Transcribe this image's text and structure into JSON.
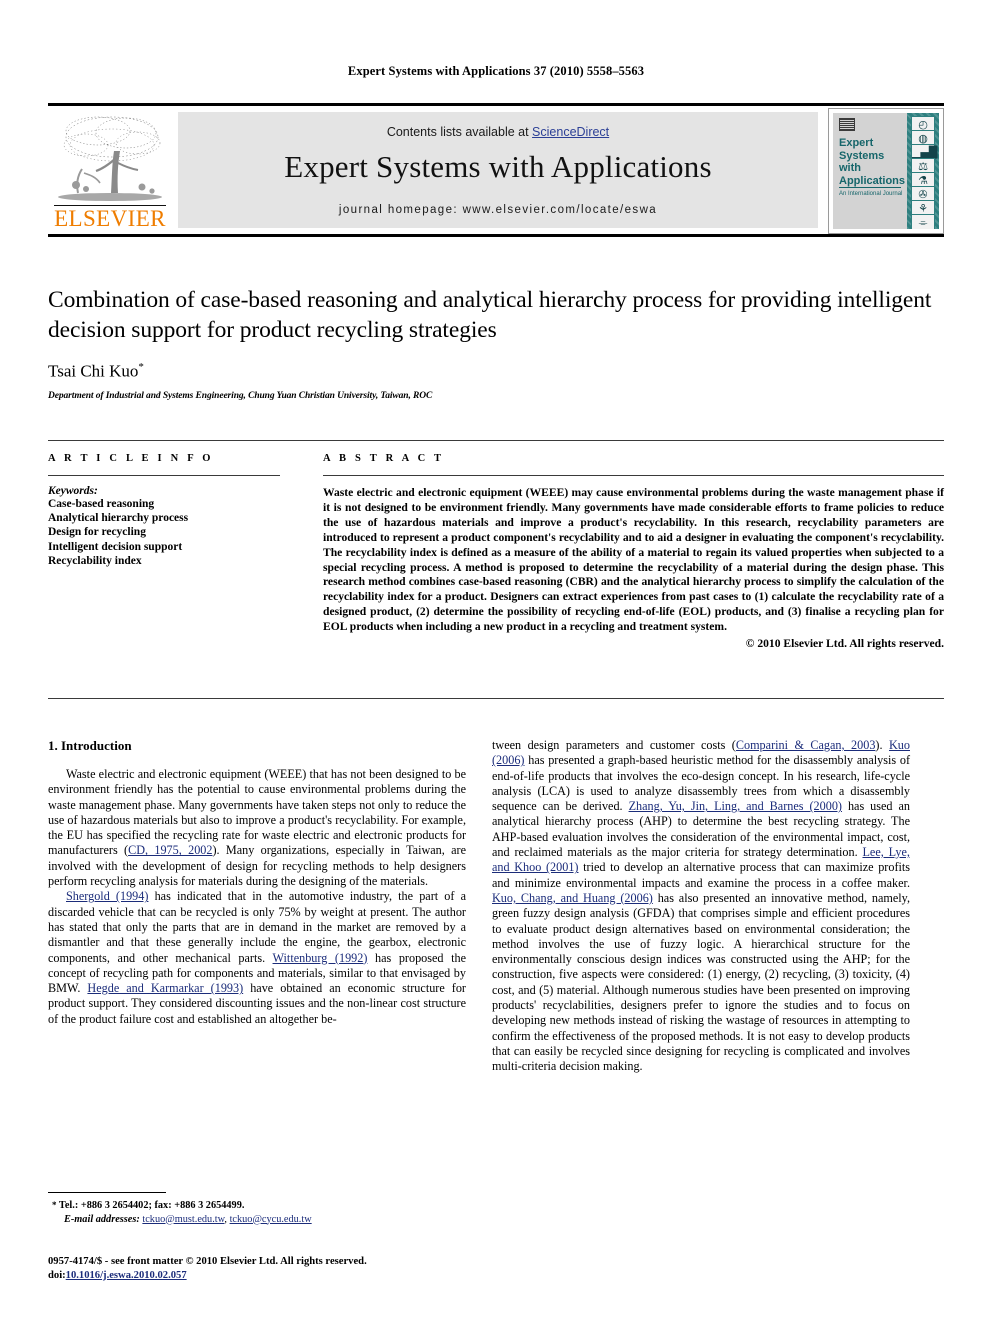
{
  "running_head": "Expert Systems with Applications 37 (2010) 5558–5563",
  "masthead": {
    "contents_prefix": "Contents lists available at ",
    "sciencedirect": "ScienceDirect",
    "journal_title": "Expert Systems with Applications",
    "homepage": "journal homepage: www.elsevier.com/locate/eswa",
    "publisher_name": "ELSEVIER",
    "publisher_logo_icon": "elsevier-tree-icon",
    "cover": {
      "title": "Expert Systems with Applications",
      "subtitle": "An International Journal",
      "strip_icons": [
        "clock-icon",
        "globe-icon",
        "bar-chart-icon",
        "scales-icon",
        "microscope-icon",
        "satellite-icon",
        "lab-flask-icon",
        "tower-icon"
      ],
      "accent_color": "#2e7f7f"
    }
  },
  "article": {
    "title": "Combination of case-based reasoning and analytical hierarchy process for providing intelligent decision support for product recycling strategies",
    "author": "Tsai Chi Kuo",
    "author_marker": "*",
    "affiliation": "Department of Industrial and Systems Engineering, Chung Yuan Christian University, Taiwan, ROC"
  },
  "article_info": {
    "heading": "A R T I C L E    I N F O",
    "keywords_label": "Keywords:",
    "keywords": [
      "Case-based reasoning",
      "Analytical hierarchy process",
      "Design for recycling",
      "Intelligent decision support",
      "Recyclability index"
    ]
  },
  "abstract": {
    "heading": "A B S T R A C T",
    "text": "Waste electric and electronic equipment (WEEE) may cause environmental problems during the waste management phase if it is not designed to be environment friendly. Many governments have made considerable efforts to frame policies to reduce the use of hazardous materials and improve a product's recyclability. In this research, recyclability parameters are introduced to represent a product component's recyclability and to aid a designer in evaluating the component's recyclability. The recyclability index is defined as a measure of the ability of a material to regain its valued properties when subjected to a special recycling process. A method is proposed to determine the recyclability of a material during the design phase. This research method combines case-based reasoning (CBR) and the analytical hierarchy process to simplify the calculation of the recyclability index for a product. Designers can extract experiences from past cases to (1) calculate the recyclability rate of a designed product, (2) determine the possibility of recycling end-of-life (EOL) products, and (3) finalise a recycling plan for EOL products when including a new product in a recycling and treatment system.",
    "copyright": "© 2010 Elsevier Ltd. All rights reserved."
  },
  "introduction": {
    "section_title": "1. Introduction",
    "left_paragraph_1_a": "Waste electric and electronic equipment (WEEE) that has not been designed to be environment friendly has the potential to cause environmental problems during the waste management phase. Many governments have taken steps not only to reduce the use of hazardous materials but also to improve a product's recyclability. For example, the EU has specified the recycling rate for waste electric and electronic products for manufacturers (",
    "left_cite_1": "CD, 1975, 2002",
    "left_paragraph_1_b": "). Many organizations, especially in Taiwan, are involved with the development of design for recycling methods to help designers perform recycling analysis for materials during the designing of the materials.",
    "left_cite_2": "Shergold (1994)",
    "left_paragraph_2_a": " has indicated that in the automotive industry, the part of a discarded vehicle that can be recycled is only 75% by weight at present. The author has stated that only the parts that are in demand in the market are removed by a dismantler and that these generally include the engine, the gearbox, electronic components, and other mechanical parts. ",
    "left_cite_3": "Wittenburg (1992)",
    "left_paragraph_2_b": " has proposed the concept of recycling path for components and materials, similar to that envisaged by BMW. ",
    "left_cite_4": "Hegde and Karmarkar (1993)",
    "left_paragraph_2_c": " have obtained an economic structure for product support. They considered discounting issues and the non-linear cost structure of the product failure cost and established an altogether be-",
    "right_paragraph_a": "tween design parameters and customer costs (",
    "right_cite_1": "Comparini & Cagan, 2003",
    "right_paragraph_b": "). ",
    "right_cite_2": "Kuo (2006)",
    "right_paragraph_c": " has presented a graph-based heuristic method for the disassembly analysis of end-of-life products that involves the eco-design concept. In his research, life-cycle analysis (LCA) is used to analyze disassembly trees from which a disassembly sequence can be derived. ",
    "right_cite_3": "Zhang, Yu, Jin, Ling, and Barnes (2000)",
    "right_paragraph_d": " has used an analytical hierarchy process (AHP) to determine the best recycling strategy. The AHP-based evaluation involves the consideration of the environmental impact, cost, and reclaimed materials as the major criteria for strategy determination. ",
    "right_cite_4": "Lee, Lye, and Khoo (2001)",
    "right_paragraph_e": " tried to develop an alternative process that can maximize profits and minimize environmental impacts and examine the process in a coffee maker. ",
    "right_cite_5": "Kuo, Chang, and Huang (2006)",
    "right_paragraph_f": " has also presented an innovative method, namely, green fuzzy design analysis (GFDA) that comprises simple and efficient procedures to evaluate product design alternatives based on environmental consideration; the method involves the use of fuzzy logic. A hierarchical structure for the environmentally conscious design indices was constructed using the AHP; for the construction, five aspects were considered: (1) energy, (2) recycling, (3) toxicity, (4) cost, and (5) material. Although numerous studies have been presented on improving products' recyclabilities, designers prefer to ignore the studies and to focus on developing new methods instead of risking the wastage of resources in attempting to confirm the effectiveness of the proposed methods. It is not easy to develop products that can easily be recycled since designing for recycling is complicated and involves multi-criteria decision making."
  },
  "footnotes": {
    "marker": "*",
    "contact": "Tel.: +886 3 2654402; fax: +886 3 2654499.",
    "email_label": "E-mail addresses:",
    "email_1": "tckuo@must.edu.tw",
    "email_separator": ", ",
    "email_2": "tckuo@cycu.edu.tw"
  },
  "imprint": {
    "line1": "0957-4174/$ - see front matter © 2010 Elsevier Ltd. All rights reserved.",
    "doi_label": "doi:",
    "doi_value": "10.1016/j.eswa.2010.02.057"
  }
}
